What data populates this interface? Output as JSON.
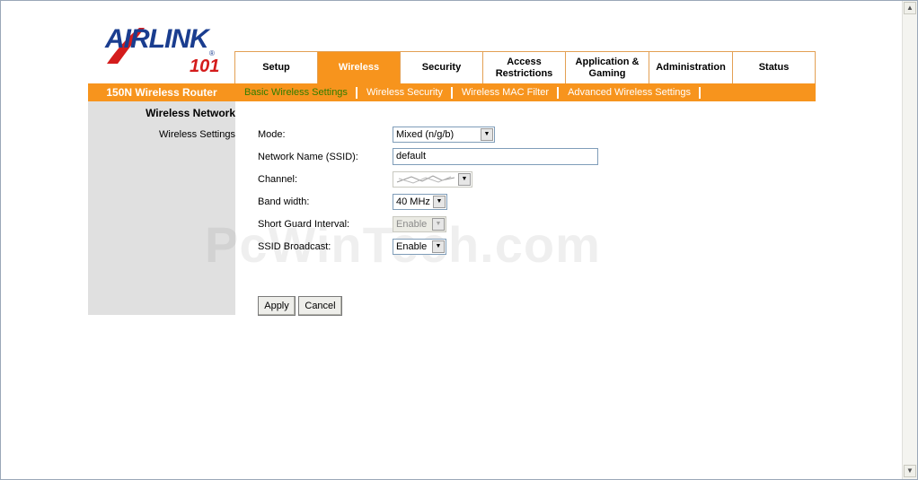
{
  "logo": {
    "brand": "AIRLINK",
    "number": "101",
    "reg": "®"
  },
  "tabs": [
    {
      "label": "Setup"
    },
    {
      "label": "Wireless"
    },
    {
      "label": "Security"
    },
    {
      "label": "Access Restrictions"
    },
    {
      "label": "Application & Gaming"
    },
    {
      "label": "Administration"
    },
    {
      "label": "Status"
    }
  ],
  "product_name": "150N Wireless Router",
  "subnav": [
    {
      "label": "Basic Wireless Settings"
    },
    {
      "label": "Wireless Security"
    },
    {
      "label": "Wireless MAC Filter"
    },
    {
      "label": "Advanced Wireless Settings"
    }
  ],
  "side": {
    "heading": "Wireless Network",
    "item": "Wireless Settings"
  },
  "form": {
    "mode_label": "Mode:",
    "mode_value": "Mixed (n/g/b)",
    "ssid_label": "Network Name (SSID):",
    "ssid_value": "default",
    "channel_label": "Channel:",
    "bandwidth_label": "Band width:",
    "bandwidth_value": "40 MHz",
    "guard_label": "Short Guard Interval:",
    "guard_value": "Enable",
    "broadcast_label": "SSID Broadcast:",
    "broadcast_value": "Enable"
  },
  "buttons": {
    "apply": "Apply",
    "cancel": "Cancel"
  },
  "watermark": "PcWinTech.com",
  "colors": {
    "accent": "#f7941d",
    "active_subnav": "#2e7d00",
    "side_bg": "#e0e0e0"
  }
}
